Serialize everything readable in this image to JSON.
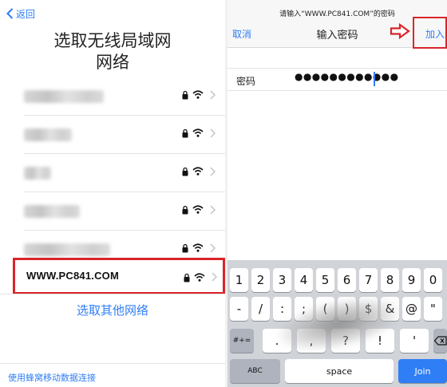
{
  "left": {
    "back_label": "返回",
    "title_line1": "选取无线局域网",
    "title_line2": "网络",
    "networks": [
      {
        "name": "",
        "blurred": true
      },
      {
        "name": "",
        "blurred": true
      },
      {
        "name": "",
        "blurred": true
      },
      {
        "name": "",
        "blurred": true
      },
      {
        "name": "",
        "blurred": true
      }
    ],
    "selected_network": "WWW.PC841.COM",
    "other_network_label": "选取其他网络",
    "cellular_label": "使用蜂窝移动数据连接"
  },
  "right": {
    "prompt": "请输入“WWW.PC841.COM”的密码",
    "cancel_label": "取消",
    "nav_title": "输入密码",
    "join_label": "加入",
    "password_label": "密码",
    "password_value": "●●●●●●●●●●●●"
  },
  "keyboard": {
    "row1": [
      "1",
      "2",
      "3",
      "4",
      "5",
      "6",
      "7",
      "8",
      "9",
      "0"
    ],
    "row2": [
      "-",
      "/",
      ":",
      ";",
      "(",
      ")",
      "$",
      "&",
      "@",
      "\""
    ],
    "row3": [
      "#+=",
      ".",
      ",",
      "?",
      "!",
      "'"
    ],
    "row4": [
      "ABC",
      "space",
      "Join"
    ]
  },
  "colors": {
    "accent": "#2f7ef6",
    "highlight": "#d9252b",
    "keyboard_bg": "#d0d3d8"
  }
}
